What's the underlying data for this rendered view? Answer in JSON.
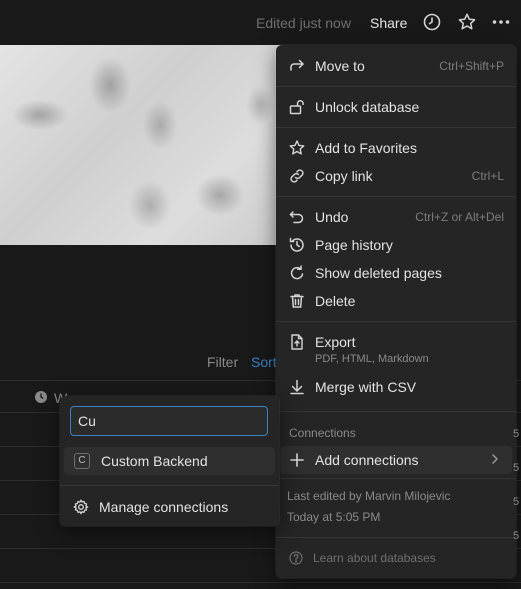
{
  "topbar": {
    "edited": "Edited just now",
    "share": "Share",
    "icons": [
      "clock-icon",
      "star-icon",
      "more-icon"
    ]
  },
  "table": {
    "filter": "Filter",
    "sort": "Sort",
    "column_first_letter": "W"
  },
  "menu": {
    "items": [
      {
        "label": "Move to",
        "shortcut": "Ctrl+Shift+P",
        "icon": "arrow-turn-icon"
      },
      {
        "label": "Unlock database",
        "icon": "unlock-icon"
      },
      {
        "label": "Add to Favorites",
        "icon": "star-icon"
      },
      {
        "label": "Copy link",
        "shortcut": "Ctrl+L",
        "icon": "link-icon"
      },
      {
        "label": "Undo",
        "shortcut": "Ctrl+Z or Alt+Del",
        "icon": "undo-icon"
      },
      {
        "label": "Page history",
        "icon": "history-icon"
      },
      {
        "label": "Show deleted pages",
        "icon": "restore-icon"
      },
      {
        "label": "Delete",
        "icon": "trash-icon"
      },
      {
        "label": "Export",
        "sub": "PDF, HTML, Markdown",
        "icon": "export-icon"
      },
      {
        "label": "Merge with CSV",
        "icon": "download-arrow-icon"
      }
    ],
    "connections_section": "Connections",
    "add_connections": "Add connections",
    "last_edited_by": "Last edited by Marvin Milojevic",
    "last_edited_time": "Today at 5:05 PM",
    "learn": "Learn about databases"
  },
  "submenu": {
    "search_value": "Cu",
    "connection_badge": "C",
    "connection_label": "Custom Backend",
    "manage": "Manage connections"
  },
  "colors": {
    "background": "#191919",
    "menu_bg": "#252525",
    "accent": "#3b82c4"
  }
}
